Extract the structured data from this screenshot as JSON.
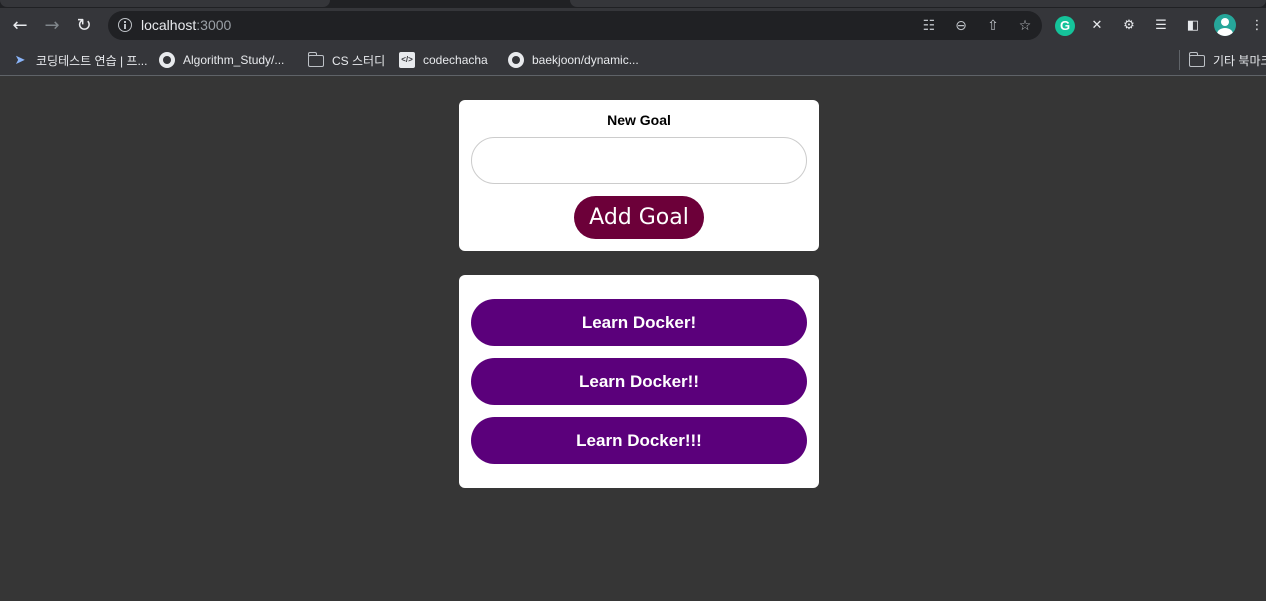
{
  "browser": {
    "url_host": "localhost",
    "url_port": ":3000",
    "bookmarks": [
      {
        "label": "코딩테스트 연습 | 프...",
        "icon": "bird-icon"
      },
      {
        "label": "Algorithm_Study/...",
        "icon": "github-icon"
      },
      {
        "label": "CS 스터디",
        "icon": "folder-icon"
      },
      {
        "label": "codechacha",
        "icon": "code-icon"
      },
      {
        "label": "baekjoon/dynamic...",
        "icon": "github-icon"
      },
      {
        "label": "기타 북마크",
        "icon": "folder-icon"
      }
    ]
  },
  "goal_form": {
    "label": "New Goal",
    "input_value": "",
    "button_label": "Add Goal"
  },
  "goals": [
    {
      "text": "Learn Docker!"
    },
    {
      "text": "Learn Docker!!"
    },
    {
      "text": "Learn Docker!!!"
    }
  ],
  "colors": {
    "page_background": "#363636",
    "add_button": "#6c0039",
    "goal_item": "#5b007b"
  }
}
